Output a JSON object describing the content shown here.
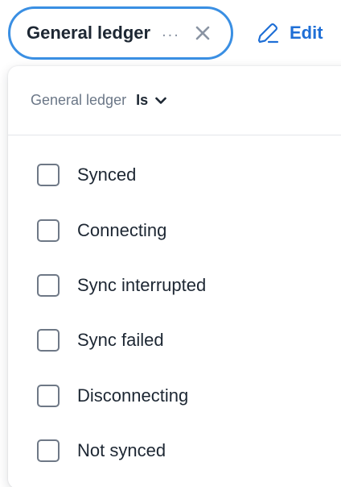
{
  "filter_chip": {
    "label": "General ledger",
    "ellipsis": "...",
    "close_icon": "close-icon"
  },
  "edit_button": {
    "label": "Edit",
    "icon": "pencil-icon",
    "color": "#1f6fd6"
  },
  "dropdown": {
    "field_label": "General ledger",
    "operator_label": "Is",
    "operator_icon": "chevron-down-icon",
    "options": [
      {
        "label": "Synced",
        "checked": false
      },
      {
        "label": "Connecting",
        "checked": false
      },
      {
        "label": "Sync interrupted",
        "checked": false
      },
      {
        "label": "Sync failed",
        "checked": false
      },
      {
        "label": "Disconnecting",
        "checked": false
      },
      {
        "label": "Not synced",
        "checked": false
      }
    ]
  },
  "colors": {
    "chip_border": "#3a8fe3",
    "text_primary": "#1d2733",
    "text_muted": "#6b7787",
    "checkbox_border": "#6e7886"
  }
}
